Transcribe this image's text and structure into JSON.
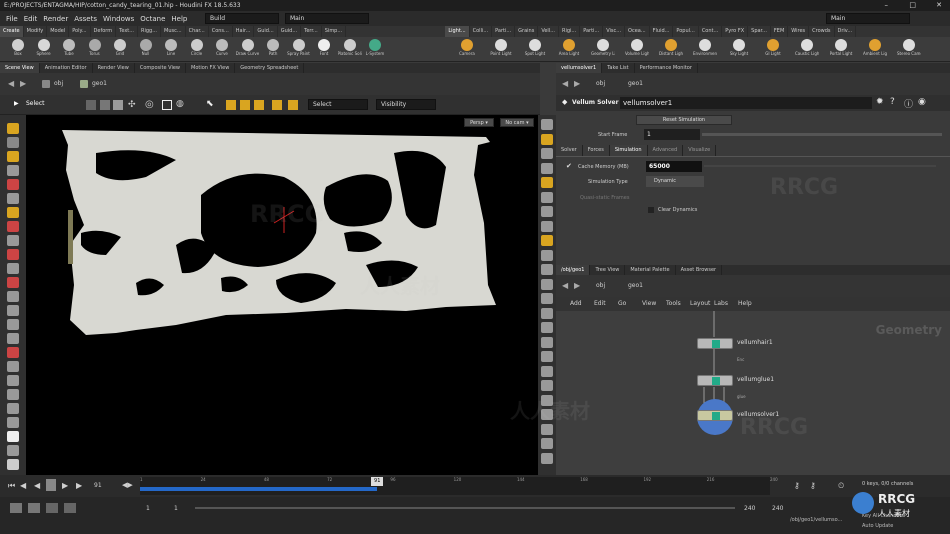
{
  "titlebar": {
    "text": "E:/PROJECTS/ENTAGMA/HIP/cotton_candy_tearing_01.hip - Houdini FX 18.5.633",
    "min": "–",
    "max": "□",
    "close": "✕"
  },
  "menu": [
    "File",
    "Edit",
    "Render",
    "Assets",
    "Windows",
    "Octane",
    "Help"
  ],
  "desktop_dropdown": "Build",
  "main_dropdown": "Main",
  "main_dropdown_right": "Main",
  "shelf_tabs_left": [
    "Create",
    "Modify",
    "Model",
    "Poly...",
    "Deform",
    "Text...",
    "Rigg...",
    "Musc...",
    "Char...",
    "Cons...",
    "Hair...",
    "Guid...",
    "Guid...",
    "Terr...",
    "Simp..."
  ],
  "shelf_tabs_right": [
    "Light...",
    "Colli...",
    "Parti...",
    "Grains",
    "Vell...",
    "Rigi...",
    "Parti...",
    "Visc...",
    "Ocea...",
    "Fluid...",
    "Popul...",
    "Cont...",
    "Pyro FX",
    "Spar...",
    "FEM",
    "Wires",
    "Crowds",
    "Driv..."
  ],
  "shelf_tools_left": [
    "Box",
    "Sphere",
    "Tube",
    "Torus",
    "Grid",
    "Null",
    "Line",
    "Circle",
    "Curve",
    "Draw Curve",
    "Path",
    "Spray Paint",
    "Font",
    "Platonic Solids",
    "L-System"
  ],
  "shelf_tools_right": [
    "Camera",
    "Point Light",
    "Spot Light",
    "Area Light",
    "Geometry Light",
    "Volume Light",
    "Distant Light",
    "Environment Light",
    "Sky Light",
    "GI Light",
    "Caustic Light",
    "Portal Light",
    "Ambient Light",
    "Stereo Camera"
  ],
  "viewer_tabs": [
    "Scene View",
    "Animation Editor",
    "Render View",
    "Composite View",
    "Motion FX View",
    "Geometry Spreadsheet"
  ],
  "viewer_path": [
    "obj",
    "geo1"
  ],
  "viewer_toolbar": {
    "select_label": "Select",
    "select_dd": "Select",
    "visibility_dd": "Visibility"
  },
  "viewport": {
    "persp": "Persp ▾",
    "cam": "No cam ▾"
  },
  "param_tabs": [
    "vellumsolver1",
    "Take List",
    "Performance Monitor"
  ],
  "param_path": [
    "obj",
    "geo1"
  ],
  "node_type": "Vellum Solver",
  "node_name": "vellumsolver1",
  "params": {
    "reset_sim": "Reset Simulation",
    "start_frame_label": "Start Frame",
    "start_frame": "1",
    "subtabs": [
      "Solver",
      "Forces",
      "Simulation",
      "Advanced",
      "Visualize"
    ],
    "cache_memory_label": "Cache Memory (MB)",
    "cache_memory": "65000",
    "sim_type_label": "Simulation Type",
    "sim_type": "Dynamic",
    "quasi_label": "Quasi-static Frames",
    "clear_dynamics": "Clear Dynamics"
  },
  "net_tabs": [
    "/obj/geo1",
    "Tree View",
    "Material Palette",
    "Asset Browser"
  ],
  "net_path": [
    "obj",
    "geo1"
  ],
  "net_menu": [
    "Add",
    "Edit",
    "Go",
    "View",
    "Tools",
    "Layout",
    "Labs",
    "Help"
  ],
  "net_context": "Geometry",
  "nodes": [
    {
      "name": "vellumhair1",
      "sub": "Enc"
    },
    {
      "name": "vellumglue1",
      "sub": "glue"
    },
    {
      "name": "vellumsolver1",
      "sub": ""
    }
  ],
  "timeline": {
    "ticks": [
      "1",
      "24",
      "48",
      "72",
      "96",
      "120",
      "144",
      "168",
      "192",
      "216",
      "240"
    ],
    "current": "91",
    "range_start": "1",
    "range_end": "240",
    "start": "1",
    "end": "240",
    "current_frame_field": "91"
  },
  "status": {
    "channels": "0 keys, 0/0 channels",
    "path": "/obj/geo1/vellumso...",
    "auto_update": "Auto Update",
    "key_all": "Key All Channels"
  },
  "watermarks": [
    "RRCG",
    "人人素材",
    "RRCG",
    "人人素材",
    "RRCG"
  ],
  "logo": {
    "brand": "RRCG",
    "sub": "人人素材"
  }
}
